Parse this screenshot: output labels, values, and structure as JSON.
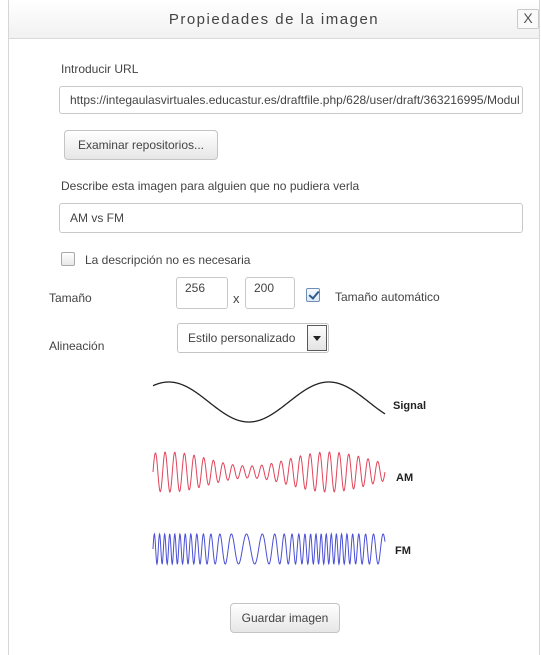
{
  "dialog": {
    "title": "Propiedades de la imagen",
    "close_label": "X"
  },
  "url": {
    "label": "Introducir URL",
    "value": "https://integaulasvirtuales.educastur.es/draftfile.php/628/user/draft/363216995/Modul"
  },
  "browse_button": "Examinar repositorios...",
  "description": {
    "label": "Describe esta imagen para alguien que no pudiera verla",
    "value": "AM vs FM"
  },
  "no_description": {
    "label": "La descripción no es necesaria",
    "checked": false
  },
  "size": {
    "label": "Tamaño",
    "width": "256",
    "separator": "x",
    "height": "200",
    "auto_label": "Tamaño automático",
    "auto_checked": true
  },
  "alignment": {
    "label": "Alineación",
    "selected": "Estilo personalizado"
  },
  "preview": {
    "labels": [
      "Signal",
      "AM",
      "FM"
    ],
    "colors": {
      "signal": "#222222",
      "am": "#e0455a",
      "fm": "#4a4fd6"
    }
  },
  "save_button": "Guardar imagen"
}
